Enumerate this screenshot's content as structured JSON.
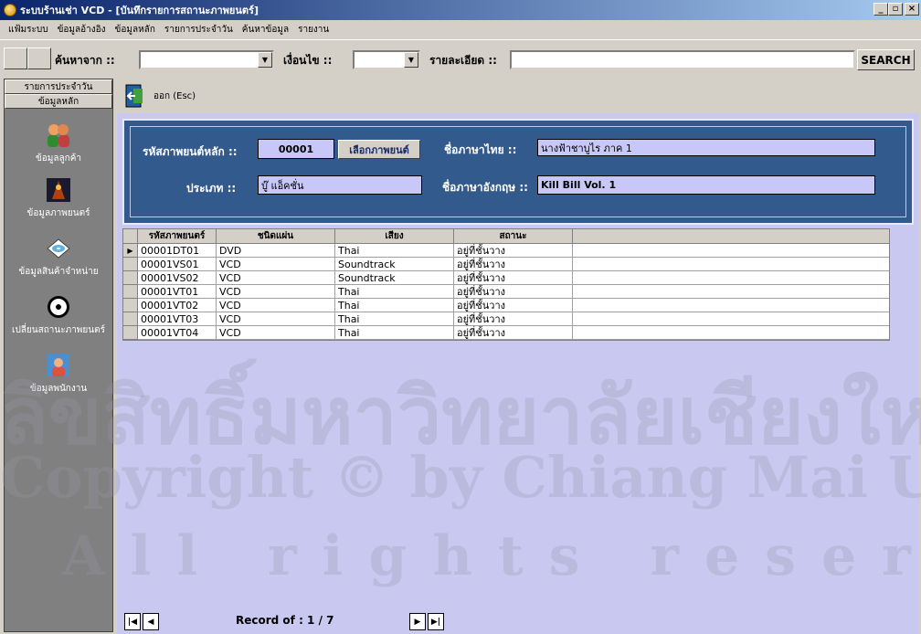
{
  "window": {
    "title": "ระบบร้านเช่า VCD - [บันทึกรายการสถานะภาพยนตร์]",
    "minimize": "_",
    "restore": "▫",
    "close": "×"
  },
  "menu": [
    "แฟ้มระบบ",
    "ข้อมูลอ้างอิง",
    "ข้อมูลหลัก",
    "รายการประจำวัน",
    "ค้นหาข้อมูล",
    "รายงาน"
  ],
  "search": {
    "from_label": "ค้นหาจาก ::",
    "from_value": "",
    "condition_label": "เงื่อนไข ::",
    "condition_value": "",
    "detail_label": "รายละเอียด ::",
    "detail_value": "",
    "button": "SEARCH"
  },
  "sidebar": {
    "tabs": [
      "รายการประจำวัน",
      "ข้อมูลหลัก"
    ],
    "items": [
      {
        "label": "ข้อมูลลูกค้า",
        "icon": "customers-icon"
      },
      {
        "label": "ข้อมูลภาพยนตร์",
        "icon": "movie-icon"
      },
      {
        "label": "ข้อมูลสินค้าจำหน่าย",
        "icon": "disc-product-icon"
      },
      {
        "label": "เปลี่ยนสถานะภาพยนตร์",
        "icon": "status-disc-icon"
      },
      {
        "label": "ข้อมูลพนักงาน",
        "icon": "employee-icon"
      }
    ]
  },
  "toolbar": {
    "exit_label": "ออก (Esc)"
  },
  "form": {
    "main_code_label": "รหัสภาพยนต์หลัก ::",
    "main_code_value": "00001",
    "select_button": "เลือกภาพยนต์",
    "thai_name_label": "ชื่อภาษาไทย ::",
    "thai_name_value": "นางฟ้าชาบูไร ภาค 1",
    "type_label": "ประเภท ::",
    "type_value": "บู๊ แอ็คชั่น",
    "eng_name_label": "ชื่อภาษาอังกฤษ ::",
    "eng_name_value": "Kill Bill Vol. 1"
  },
  "grid": {
    "headers": [
      "รหัสภาพยนตร์",
      "ชนิดแผ่น",
      "เสียง",
      "สถานะ",
      ""
    ],
    "rows": [
      [
        "00001DT01",
        "DVD",
        "Thai",
        "อยู่ที่ชั้นวาง"
      ],
      [
        "00001VS01",
        "VCD",
        "Soundtrack",
        "อยู่ที่ชั้นวาง"
      ],
      [
        "00001VS02",
        "VCD",
        "Soundtrack",
        "อยู่ที่ชั้นวาง"
      ],
      [
        "00001VT01",
        "VCD",
        "Thai",
        "อยู่ที่ชั้นวาง"
      ],
      [
        "00001VT02",
        "VCD",
        "Thai",
        "อยู่ที่ชั้นวาง"
      ],
      [
        "00001VT03",
        "VCD",
        "Thai",
        "อยู่ที่ชั้นวาง"
      ],
      [
        "00001VT04",
        "VCD",
        "Thai",
        "อยู่ที่ชั้นวาง"
      ]
    ],
    "selected_row": 0
  },
  "record": {
    "label": "Record of  :  1 / 7"
  },
  "watermark": {
    "line1": "ลิขสิทธิ์มหาวิทยาลัยเชียงใหม่",
    "line2": "Copyright © by Chiang Mai University",
    "line3": "All rights reserved"
  },
  "colors": {
    "accent": "#335a8c",
    "panel": "#c8c8f0",
    "sidebar": "#808080"
  }
}
